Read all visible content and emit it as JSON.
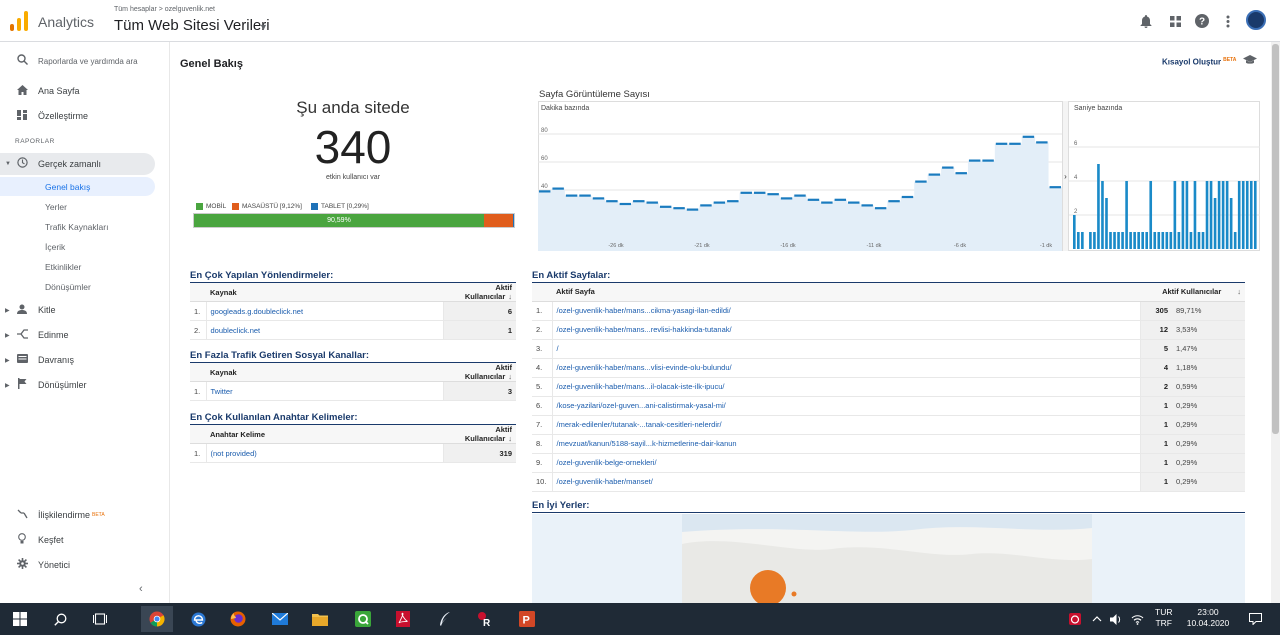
{
  "header": {
    "app_name": "Analytics",
    "breadcrumb": "Tüm hesaplar > ozelguvenlik.net",
    "property": "Tüm Web Sitesi Verileri"
  },
  "sidebar": {
    "search": "Raporlarda ve yardımda ara",
    "home": "Ana Sayfa",
    "customize": "Özelleştirme",
    "section": "RAPORLAR",
    "realtime": "Gerçek zamanlı",
    "sub": [
      "Genel bakış",
      "Yerler",
      "Trafik Kaynakları",
      "İçerik",
      "Etkinlikler",
      "Dönüşümler"
    ],
    "audience": "Kitle",
    "acquisition": "Edinme",
    "behavior": "Davranış",
    "conversions": "Dönüşümler",
    "attribution": "İlişkilendirme",
    "attribution_badge": "BETA",
    "discover": "Keşfet",
    "admin": "Yönetici"
  },
  "page": {
    "title": "Genel Bakış",
    "shortcut": "Kısayol Oluştur",
    "shortcut_badge": "BETA"
  },
  "realtime": {
    "now_label": "Şu anda sitede",
    "count": "340",
    "count_sub": "etkin kullanıcı var",
    "legend_mobile": "MOBİL",
    "legend_desktop": "MASAÜSTÜ [9,12%]",
    "legend_tablet": "TABLET [0,29%]",
    "mobile_pct_label": "90,59%",
    "mobile_pct": 90.59,
    "desktop_pct": 9.12,
    "tablet_pct": 0.29,
    "colors": {
      "mobile": "#4aa53f",
      "desktop": "#e05d1c",
      "tablet": "#1f72b8"
    }
  },
  "pageviews": {
    "title": "Sayfa Görüntüleme Sayısı",
    "minute_label": "Dakika bazında",
    "second_label": "Saniye bazında"
  },
  "chart_data": [
    {
      "type": "area",
      "title": "Dakika bazında",
      "x_ticks": [
        "-26 dk",
        "-21 dk",
        "-16 dk",
        "-11 dk",
        "-6 dk",
        "-1 dk"
      ],
      "y_ticks": [
        20,
        40,
        60,
        80
      ],
      "ylim": [
        5,
        95
      ],
      "values": [
        39,
        41,
        36,
        36,
        34,
        32,
        30,
        32,
        31,
        28,
        27,
        26,
        29,
        31,
        32,
        38,
        38,
        37,
        34,
        36,
        33,
        31,
        33,
        31,
        29,
        27,
        32,
        35,
        46,
        51,
        56,
        52,
        61,
        61,
        73,
        73,
        78,
        74,
        42
      ]
    },
    {
      "type": "bar",
      "title": "Saniye bazında",
      "y_ticks": [
        2,
        4,
        6
      ],
      "ylim": [
        0,
        8
      ],
      "values": [
        2,
        1,
        1,
        0,
        1,
        1,
        5,
        4,
        3,
        1,
        1,
        1,
        1,
        4,
        1,
        1,
        1,
        1,
        1,
        4,
        1,
        1,
        1,
        1,
        1,
        4,
        1,
        4,
        4,
        1,
        4,
        1,
        1,
        4,
        4,
        3,
        4,
        4,
        4,
        3,
        1,
        4,
        4,
        4,
        4,
        4
      ]
    }
  ],
  "referrals": {
    "title": "En Çok Yapılan Yönlendirmeler:",
    "col1": "Kaynak",
    "col2": "Aktif Kullanıcılar",
    "rows": [
      {
        "idx": "1.",
        "source": "googleads.g.doubleclick.net",
        "value": "6"
      },
      {
        "idx": "2.",
        "source": "doubleclick.net",
        "value": "1"
      }
    ]
  },
  "social": {
    "title": "En Fazla Trafik Getiren Sosyal Kanallar:",
    "col1": "Kaynak",
    "col2": "Aktif Kullanıcılar",
    "rows": [
      {
        "idx": "1.",
        "source": "Twitter",
        "value": "3"
      }
    ]
  },
  "keywords": {
    "title": "En Çok Kullanılan Anahtar Kelimeler:",
    "col1": "Anahtar Kelime",
    "col2": "Aktif Kullanıcılar",
    "rows": [
      {
        "idx": "1.",
        "source": "(not provided)",
        "value": "319"
      }
    ]
  },
  "pages": {
    "title": "En Aktif Sayfalar:",
    "col1": "Aktif Sayfa",
    "col2": "Aktif Kullanıcılar",
    "rows": [
      {
        "idx": "1.",
        "page": "/ozel-guvenlik-haber/mans...cikma-yasagi-ilan-edildi/",
        "value": "305",
        "pct": "89,71%"
      },
      {
        "idx": "2.",
        "page": "/ozel-guvenlik-haber/mans...revlisi-hakkinda-tutanak/",
        "value": "12",
        "pct": "3,53%"
      },
      {
        "idx": "3.",
        "page": "/",
        "value": "5",
        "pct": "1,47%"
      },
      {
        "idx": "4.",
        "page": "/ozel-guvenlik-haber/mans...vlisi-evinde-olu-bulundu/",
        "value": "4",
        "pct": "1,18%"
      },
      {
        "idx": "5.",
        "page": "/ozel-guvenlik-haber/mans...il-olacak-iste-ilk-ipucu/",
        "value": "2",
        "pct": "0,59%"
      },
      {
        "idx": "6.",
        "page": "/kose-yazilari/ozel-guven...ani-calistirmak-yasal-mi/",
        "value": "1",
        "pct": "0,29%"
      },
      {
        "idx": "7.",
        "page": "/merak-edilenler/tutanak-...tanak-cesitleri-nelerdir/",
        "value": "1",
        "pct": "0,29%"
      },
      {
        "idx": "8.",
        "page": "/mevzuat/kanun/5188-sayil...k-hizmetlerine-dair-kanun",
        "value": "1",
        "pct": "0,29%"
      },
      {
        "idx": "9.",
        "page": "/ozel-guvenlik-belge-ornekleri/",
        "value": "1",
        "pct": "0,29%"
      },
      {
        "idx": "10.",
        "page": "/ozel-guvenlik-haber/manset/",
        "value": "1",
        "pct": "0,29%"
      }
    ]
  },
  "places": {
    "title": "En İyi Yerler:"
  },
  "taskbar": {
    "lang_top": "TUR",
    "lang_bottom": "TRF",
    "time": "23:00",
    "date": "10.04.2020"
  }
}
